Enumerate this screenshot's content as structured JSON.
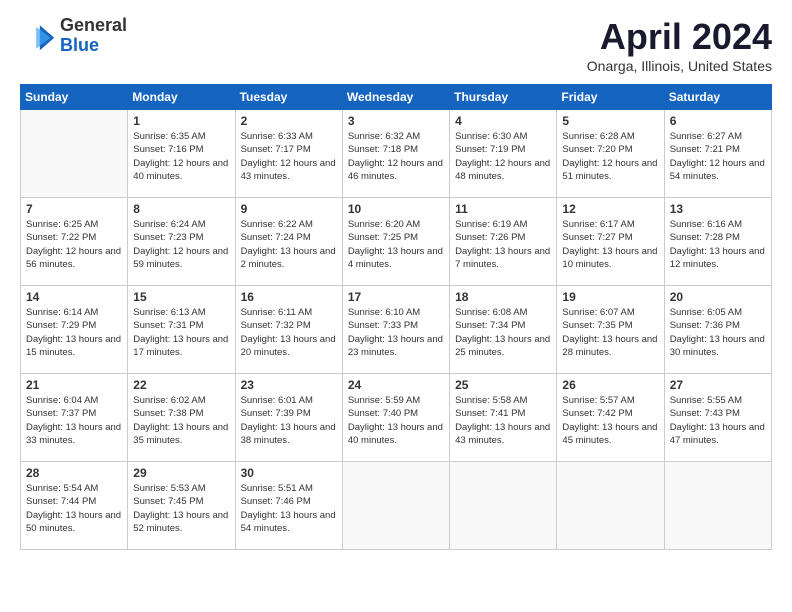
{
  "logo": {
    "general": "General",
    "blue": "Blue"
  },
  "title": "April 2024",
  "location": "Onarga, Illinois, United States",
  "weekdays": [
    "Sunday",
    "Monday",
    "Tuesday",
    "Wednesday",
    "Thursday",
    "Friday",
    "Saturday"
  ],
  "weeks": [
    [
      {
        "day": "",
        "sunrise": "",
        "sunset": "",
        "daylight": "",
        "empty": true
      },
      {
        "day": "1",
        "sunrise": "Sunrise: 6:35 AM",
        "sunset": "Sunset: 7:16 PM",
        "daylight": "Daylight: 12 hours and 40 minutes."
      },
      {
        "day": "2",
        "sunrise": "Sunrise: 6:33 AM",
        "sunset": "Sunset: 7:17 PM",
        "daylight": "Daylight: 12 hours and 43 minutes."
      },
      {
        "day": "3",
        "sunrise": "Sunrise: 6:32 AM",
        "sunset": "Sunset: 7:18 PM",
        "daylight": "Daylight: 12 hours and 46 minutes."
      },
      {
        "day": "4",
        "sunrise": "Sunrise: 6:30 AM",
        "sunset": "Sunset: 7:19 PM",
        "daylight": "Daylight: 12 hours and 48 minutes."
      },
      {
        "day": "5",
        "sunrise": "Sunrise: 6:28 AM",
        "sunset": "Sunset: 7:20 PM",
        "daylight": "Daylight: 12 hours and 51 minutes."
      },
      {
        "day": "6",
        "sunrise": "Sunrise: 6:27 AM",
        "sunset": "Sunset: 7:21 PM",
        "daylight": "Daylight: 12 hours and 54 minutes."
      }
    ],
    [
      {
        "day": "7",
        "sunrise": "Sunrise: 6:25 AM",
        "sunset": "Sunset: 7:22 PM",
        "daylight": "Daylight: 12 hours and 56 minutes."
      },
      {
        "day": "8",
        "sunrise": "Sunrise: 6:24 AM",
        "sunset": "Sunset: 7:23 PM",
        "daylight": "Daylight: 12 hours and 59 minutes."
      },
      {
        "day": "9",
        "sunrise": "Sunrise: 6:22 AM",
        "sunset": "Sunset: 7:24 PM",
        "daylight": "Daylight: 13 hours and 2 minutes."
      },
      {
        "day": "10",
        "sunrise": "Sunrise: 6:20 AM",
        "sunset": "Sunset: 7:25 PM",
        "daylight": "Daylight: 13 hours and 4 minutes."
      },
      {
        "day": "11",
        "sunrise": "Sunrise: 6:19 AM",
        "sunset": "Sunset: 7:26 PM",
        "daylight": "Daylight: 13 hours and 7 minutes."
      },
      {
        "day": "12",
        "sunrise": "Sunrise: 6:17 AM",
        "sunset": "Sunset: 7:27 PM",
        "daylight": "Daylight: 13 hours and 10 minutes."
      },
      {
        "day": "13",
        "sunrise": "Sunrise: 6:16 AM",
        "sunset": "Sunset: 7:28 PM",
        "daylight": "Daylight: 13 hours and 12 minutes."
      }
    ],
    [
      {
        "day": "14",
        "sunrise": "Sunrise: 6:14 AM",
        "sunset": "Sunset: 7:29 PM",
        "daylight": "Daylight: 13 hours and 15 minutes."
      },
      {
        "day": "15",
        "sunrise": "Sunrise: 6:13 AM",
        "sunset": "Sunset: 7:31 PM",
        "daylight": "Daylight: 13 hours and 17 minutes."
      },
      {
        "day": "16",
        "sunrise": "Sunrise: 6:11 AM",
        "sunset": "Sunset: 7:32 PM",
        "daylight": "Daylight: 13 hours and 20 minutes."
      },
      {
        "day": "17",
        "sunrise": "Sunrise: 6:10 AM",
        "sunset": "Sunset: 7:33 PM",
        "daylight": "Daylight: 13 hours and 23 minutes."
      },
      {
        "day": "18",
        "sunrise": "Sunrise: 6:08 AM",
        "sunset": "Sunset: 7:34 PM",
        "daylight": "Daylight: 13 hours and 25 minutes."
      },
      {
        "day": "19",
        "sunrise": "Sunrise: 6:07 AM",
        "sunset": "Sunset: 7:35 PM",
        "daylight": "Daylight: 13 hours and 28 minutes."
      },
      {
        "day": "20",
        "sunrise": "Sunrise: 6:05 AM",
        "sunset": "Sunset: 7:36 PM",
        "daylight": "Daylight: 13 hours and 30 minutes."
      }
    ],
    [
      {
        "day": "21",
        "sunrise": "Sunrise: 6:04 AM",
        "sunset": "Sunset: 7:37 PM",
        "daylight": "Daylight: 13 hours and 33 minutes."
      },
      {
        "day": "22",
        "sunrise": "Sunrise: 6:02 AM",
        "sunset": "Sunset: 7:38 PM",
        "daylight": "Daylight: 13 hours and 35 minutes."
      },
      {
        "day": "23",
        "sunrise": "Sunrise: 6:01 AM",
        "sunset": "Sunset: 7:39 PM",
        "daylight": "Daylight: 13 hours and 38 minutes."
      },
      {
        "day": "24",
        "sunrise": "Sunrise: 5:59 AM",
        "sunset": "Sunset: 7:40 PM",
        "daylight": "Daylight: 13 hours and 40 minutes."
      },
      {
        "day": "25",
        "sunrise": "Sunrise: 5:58 AM",
        "sunset": "Sunset: 7:41 PM",
        "daylight": "Daylight: 13 hours and 43 minutes."
      },
      {
        "day": "26",
        "sunrise": "Sunrise: 5:57 AM",
        "sunset": "Sunset: 7:42 PM",
        "daylight": "Daylight: 13 hours and 45 minutes."
      },
      {
        "day": "27",
        "sunrise": "Sunrise: 5:55 AM",
        "sunset": "Sunset: 7:43 PM",
        "daylight": "Daylight: 13 hours and 47 minutes."
      }
    ],
    [
      {
        "day": "28",
        "sunrise": "Sunrise: 5:54 AM",
        "sunset": "Sunset: 7:44 PM",
        "daylight": "Daylight: 13 hours and 50 minutes."
      },
      {
        "day": "29",
        "sunrise": "Sunrise: 5:53 AM",
        "sunset": "Sunset: 7:45 PM",
        "daylight": "Daylight: 13 hours and 52 minutes."
      },
      {
        "day": "30",
        "sunrise": "Sunrise: 5:51 AM",
        "sunset": "Sunset: 7:46 PM",
        "daylight": "Daylight: 13 hours and 54 minutes."
      },
      {
        "day": "",
        "sunrise": "",
        "sunset": "",
        "daylight": "",
        "empty": true
      },
      {
        "day": "",
        "sunrise": "",
        "sunset": "",
        "daylight": "",
        "empty": true
      },
      {
        "day": "",
        "sunrise": "",
        "sunset": "",
        "daylight": "",
        "empty": true
      },
      {
        "day": "",
        "sunrise": "",
        "sunset": "",
        "daylight": "",
        "empty": true
      }
    ]
  ]
}
